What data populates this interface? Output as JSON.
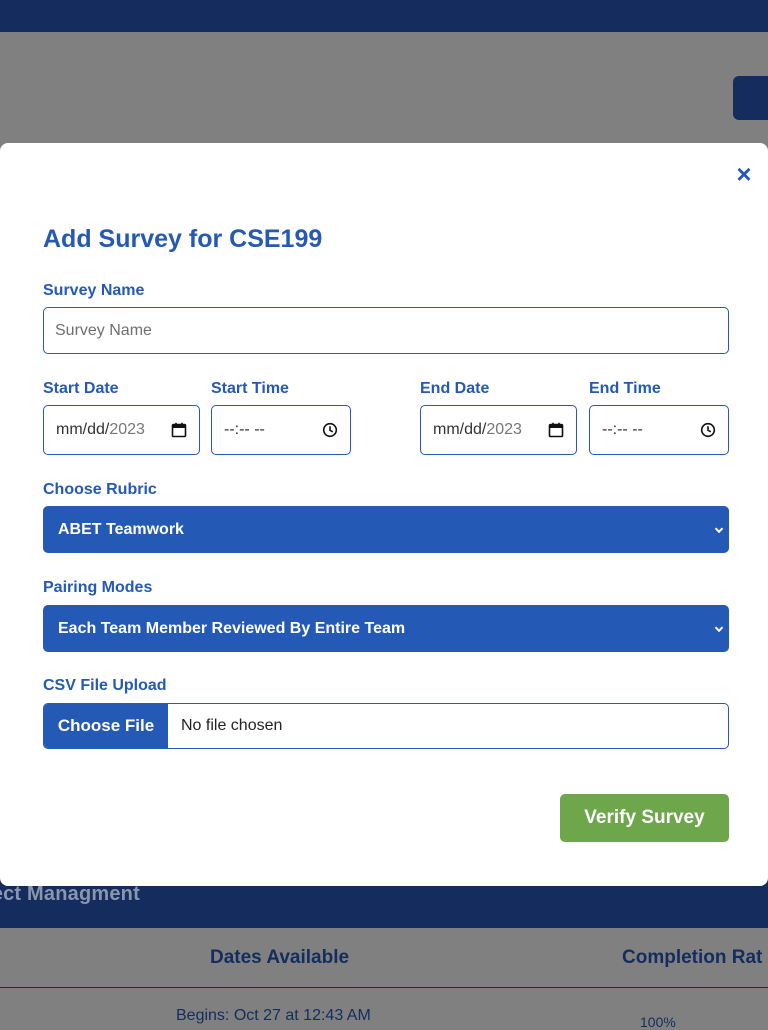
{
  "background": {
    "section_title": "ject Managment",
    "table_headers": [
      "Dates Available",
      "Completion Rat"
    ],
    "row_dates": "Begins: Oct 27 at 12:43 AM",
    "row_rate": "100%"
  },
  "modal": {
    "close_glyph": "×",
    "title": "Add Survey for CSE199",
    "survey_name": {
      "label": "Survey Name",
      "placeholder": "Survey Name",
      "value": ""
    },
    "start_date": {
      "label": "Start Date",
      "placeholder_prefix": "mm/dd/",
      "placeholder_year": "2023"
    },
    "start_time": {
      "label": "Start Time",
      "placeholder": "--:-- --"
    },
    "end_date": {
      "label": "End Date",
      "placeholder_prefix": "mm/dd/",
      "placeholder_year": "2023"
    },
    "end_time": {
      "label": "End Time",
      "placeholder": "--:-- --"
    },
    "rubric": {
      "label": "Choose Rubric",
      "selected": "ABET Teamwork"
    },
    "pairing": {
      "label": "Pairing Modes",
      "selected": "Each Team Member Reviewed By Entire Team"
    },
    "csv": {
      "label": "CSV File Upload",
      "button": "Choose File",
      "status": "No file chosen"
    },
    "verify_button": "Verify Survey"
  },
  "colors": {
    "primary": "#2459b5",
    "navy": "#142d5e",
    "success": "#6ea64b",
    "overlay": "#808080"
  },
  "icons": [
    "close-icon",
    "calendar-icon",
    "clock-icon",
    "chevron-down-icon"
  ]
}
